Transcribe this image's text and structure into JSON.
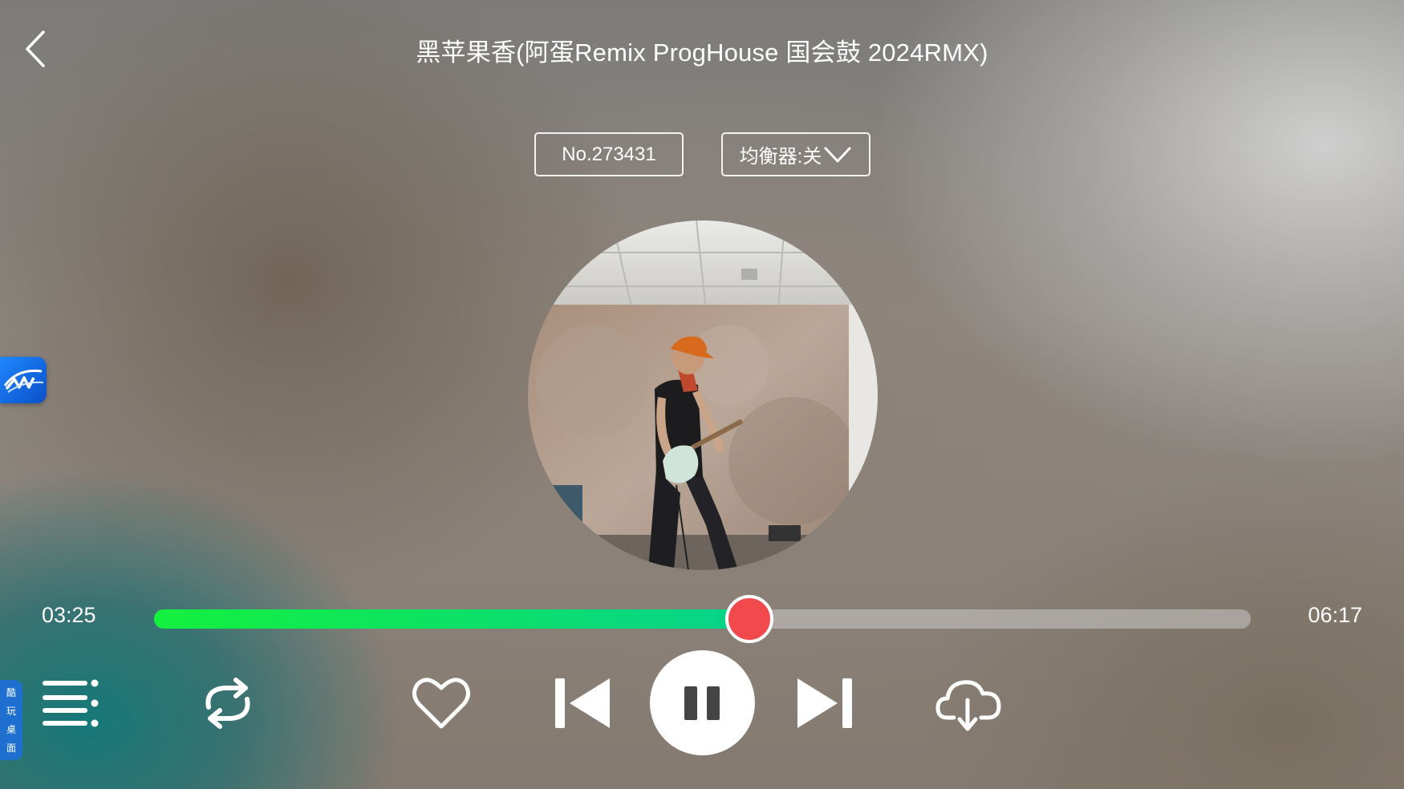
{
  "header": {
    "title": "黑苹果香(阿蛋Remix ProgHouse 国会鼓 2024RMX)"
  },
  "song_info": {
    "song_number": "No.273431",
    "equalizer_label": "均衡器:关"
  },
  "side_tab": {
    "chars": [
      "酷",
      "玩",
      "桌",
      "面"
    ]
  },
  "progress": {
    "current_time": "03:25",
    "total_time": "06:17",
    "fraction": 0.543
  },
  "colors": {
    "progress_start": "#14f03e",
    "progress_end": "#07d38b",
    "thumb": "#f24a4c"
  },
  "controls": {
    "icons": [
      "playlist-icon",
      "repeat-icon",
      "heart-icon",
      "previous-icon",
      "pause-icon",
      "next-icon",
      "cloud-download-icon"
    ]
  }
}
